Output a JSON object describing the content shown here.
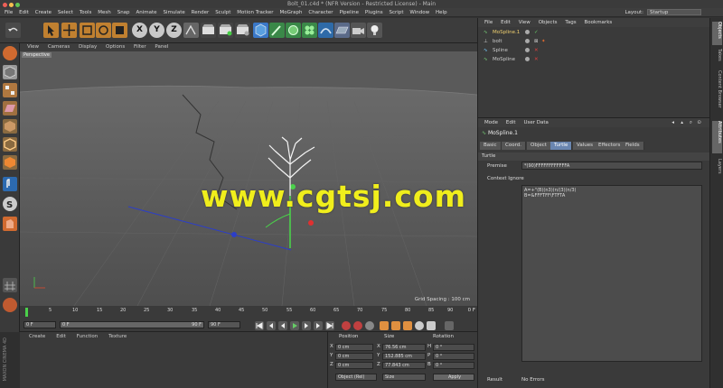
{
  "window": {
    "title": "Bolt_01.c4d * (NFR Version - Restricted License) - Main"
  },
  "menubar": {
    "items": [
      "File",
      "Edit",
      "Create",
      "Select",
      "Tools",
      "Mesh",
      "Snap",
      "Animate",
      "Simulate",
      "Render",
      "Sculpt",
      "Motion Tracker",
      "MoGraph",
      "Character",
      "Pipeline",
      "Plugins",
      "Script",
      "Window",
      "Help"
    ],
    "layout_label": "Layout:",
    "layout_value": "Startup"
  },
  "toolbar": {
    "x_label": "X",
    "y_label": "Y",
    "z_label": "Z"
  },
  "viewport": {
    "menu": [
      "View",
      "Cameras",
      "Display",
      "Options",
      "Filter",
      "Panel"
    ],
    "label": "Perspective",
    "grid_spacing": "Grid Spacing : 100 cm"
  },
  "timeline": {
    "ticks": [
      "0",
      "5",
      "10",
      "15",
      "20",
      "25",
      "30",
      "35",
      "40",
      "45",
      "50",
      "55",
      "60",
      "65",
      "70",
      "75",
      "80",
      "85",
      "90"
    ],
    "end_label": "0 F"
  },
  "transport": {
    "start": "0 F",
    "current": "0 F",
    "max_preview": "90 F",
    "end": "90 F"
  },
  "material_manager": {
    "menu": [
      "Create",
      "Edit",
      "Function",
      "Texture"
    ],
    "brand": "MAXON CINEMA 4D"
  },
  "coordinates": {
    "headers": [
      "Position",
      "Size",
      "Rotation"
    ],
    "rows": [
      {
        "axis": "X",
        "pos": "0 cm",
        "size_axis": "X",
        "size": "76.56 cm",
        "rot_axis": "H",
        "rot": "0 °"
      },
      {
        "axis": "Y",
        "pos": "0 cm",
        "size_axis": "Y",
        "size": "152.885 cm",
        "rot_axis": "P",
        "rot": "0 °"
      },
      {
        "axis": "Z",
        "pos": "0 cm",
        "size_axis": "Z",
        "size": "77.843 cm",
        "rot_axis": "B",
        "rot": "0 °"
      }
    ],
    "mode": "Object (Rel)",
    "size_mode": "Size",
    "apply": "Apply"
  },
  "object_manager": {
    "menu": [
      "File",
      "Edit",
      "View",
      "Objects",
      "Tags",
      "Bookmarks"
    ],
    "objects": [
      {
        "name": "MoSpline.1",
        "color": "#f0d070"
      },
      {
        "name": "bolt",
        "color": "#dddddd"
      },
      {
        "name": "Spline",
        "color": "#dddddd"
      },
      {
        "name": "MoSpline",
        "color": "#dddddd"
      }
    ]
  },
  "attribute_manager": {
    "menu": [
      "Mode",
      "Edit",
      "User Data"
    ],
    "object_name": "MoSpline.1",
    "tabs": [
      "Basic",
      "Coord.",
      "Object",
      "Turtle",
      "Values",
      "Effectors",
      "Fields"
    ],
    "active_tab": "Turtle",
    "section": "Turtle",
    "premise_label": "Premise",
    "premise_value": "*(90)FFFFFFFFFFFFA",
    "context_label": "Context Ignore",
    "rules_line1": "A=+\"(B)(n3)(n/(3)(n/3)",
    "rules_line2": "B=&FFFTFF\\FTFTA",
    "result_label": "Result",
    "result_value": "No Errors"
  },
  "side_tabs": [
    "Objects",
    "Takes",
    "Content Browser",
    "Attributes",
    "Layers"
  ],
  "watermark": "www.cgtsj.com",
  "colors": {
    "accent": "#6a86b0",
    "watermark": "#f0ee1c",
    "viewport_bg": "#5e5e5e"
  }
}
